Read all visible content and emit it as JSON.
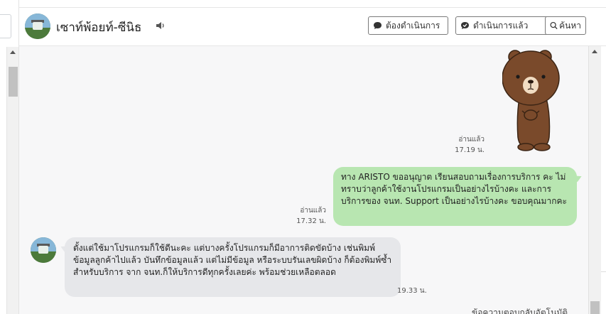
{
  "header": {
    "contact_name": "เซาท์พ้อยท์-ซีนิธ",
    "buttons": {
      "todo": "ต้องดำเนินการ",
      "done": "ดำเนินการแล้ว",
      "search": "ค้นหา"
    }
  },
  "messages": [
    {
      "type": "sticker",
      "direction": "outgoing",
      "sticker_name": "brown-bear-sticker",
      "read_status": "อ่านแล้ว",
      "time": "17.19 น."
    },
    {
      "type": "text",
      "direction": "outgoing",
      "text": "ทาง ARISTO ขออนุญาต เรียนสอบถามเรื่องการบริการ คะ ไม่ทราบว่าลูกค้าใช้งานโปรแกรมเป็นอย่างไรบ้างคะ และการบริการของ จนท. Support เป็นอย่างไรบ้างคะ ขอบคุณมากคะ",
      "read_status": "อ่านแล้ว",
      "time": "17.32 น."
    },
    {
      "type": "text",
      "direction": "incoming",
      "text": "ตั้งแต่ใช้มาโปรแกรมก็ใช้ดีนะคะ แต่บางครั้งโปรแกรมก็มีอาการติดขัดบ้าง เช่นพิมพ์ข้อมูลลูกค้าไปแล้ว บันทึกข้อมูลแล้ว แต่ไม่มีข้อมูล หรือระบบรันเลขผิดบ้าง ก็ต้องพิมพ์ซ้ำ สำหรับบริการ จาก จนท.ก็ให้บริการดีทุกครั้งเลยค่ะ พร้อมช่วยเหลือตลอด",
      "time": "19.33 น."
    }
  ],
  "cut_off_text": "ข้อความตอบกลับอัตโนมัติ",
  "colors": {
    "outgoing_bubble": "#b8e6b1",
    "incoming_bubble": "#e6e7ea",
    "chat_background": "#f7f7f8"
  }
}
